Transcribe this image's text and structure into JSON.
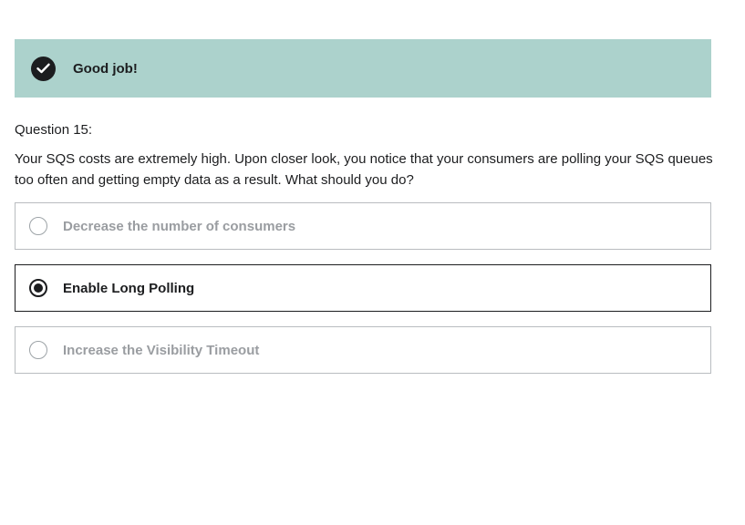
{
  "feedback": {
    "icon": "check-circle-icon",
    "text": "Good job!",
    "background_color": "#acd2cc"
  },
  "question": {
    "label": "Question 15:",
    "prompt": "Your SQS costs are extremely high. Upon closer look, you notice that your consumers are polling your SQS queues too often and getting empty data as a result. What should you do?"
  },
  "options": [
    {
      "label": "Decrease the number of consumers",
      "selected": false
    },
    {
      "label": "Enable Long Polling",
      "selected": true
    },
    {
      "label": "Increase the Visibility Timeout",
      "selected": false
    }
  ]
}
